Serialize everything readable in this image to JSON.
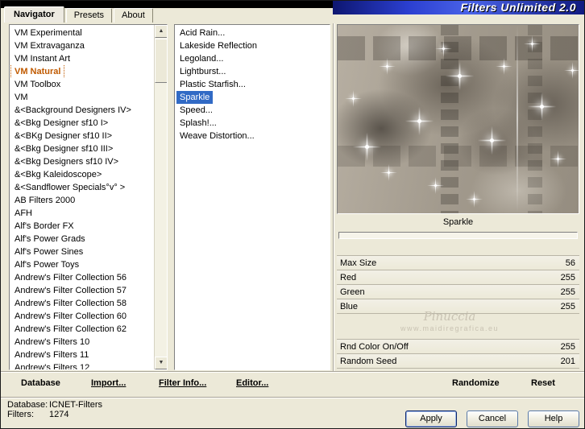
{
  "window": {
    "logo_title": "Filters Unlimited 2.0"
  },
  "tabs": {
    "items": [
      "Navigator",
      "Presets",
      "About"
    ],
    "selected": "Navigator"
  },
  "category_list": {
    "selected": "VM Natural",
    "items": [
      "VM Experimental",
      "VM Extravaganza",
      "VM Instant Art",
      "VM Natural",
      "VM Toolbox",
      "VM",
      "&<Background Designers IV>",
      "&<Bkg Designer sf10 I>",
      "&<BKg Designer sf10 II>",
      "&<Bkg Designer sf10 III>",
      "&<Bkg Designers sf10 IV>",
      "&<Bkg Kaleidoscope>",
      "&<Sandflower Specials°v° >",
      "AB Filters 2000",
      "AFH",
      "Alf's Border FX",
      "Alf's Power Grads",
      "Alf's Power Sines",
      "Alf's Power Toys",
      "Andrew's Filter Collection 56",
      "Andrew's Filter Collection 57",
      "Andrew's Filter Collection 58",
      "Andrew's Filter Collection 60",
      "Andrew's Filter Collection 62",
      "Andrew's Filters 10",
      "Andrew's Filters 11",
      "Andrew's Filters 12"
    ]
  },
  "filter_list": {
    "selected": "Sparkle",
    "items": [
      "Acid Rain...",
      "Lakeside Reflection",
      "Legoland...",
      "Lightburst...",
      "Plastic Starfish...",
      "Sparkle",
      "Speed...",
      "Splash!...",
      "Weave Distortion..."
    ]
  },
  "preview": {
    "caption": "Sparkle"
  },
  "parameters": {
    "top": [
      {
        "label": "Max Size",
        "value": "56"
      },
      {
        "label": "Red",
        "value": "255"
      },
      {
        "label": "Green",
        "value": "255"
      },
      {
        "label": "Blue",
        "value": "255"
      }
    ],
    "bottom": [
      {
        "label": "Rnd Color On/Off",
        "value": "255"
      },
      {
        "label": "Random Seed",
        "value": "201"
      }
    ]
  },
  "watermark": {
    "name": "Pinuccia",
    "url": "www.maidiregrafica.eu"
  },
  "toolbar": {
    "database": "Database",
    "import": "Import...",
    "filter_info": "Filter Info...",
    "editor": "Editor...",
    "randomize": "Randomize",
    "reset": "Reset"
  },
  "status": {
    "database_label": "Database:",
    "database_value": "ICNET-Filters",
    "filters_label": "Filters:",
    "filters_value": "1274"
  },
  "action_buttons": {
    "apply": "Apply",
    "cancel": "Cancel",
    "help": "Help"
  },
  "colors": {
    "accent_blue": "#316AC5",
    "selected_category": "#C05A00",
    "dialog_bg": "#ECE9D8"
  }
}
